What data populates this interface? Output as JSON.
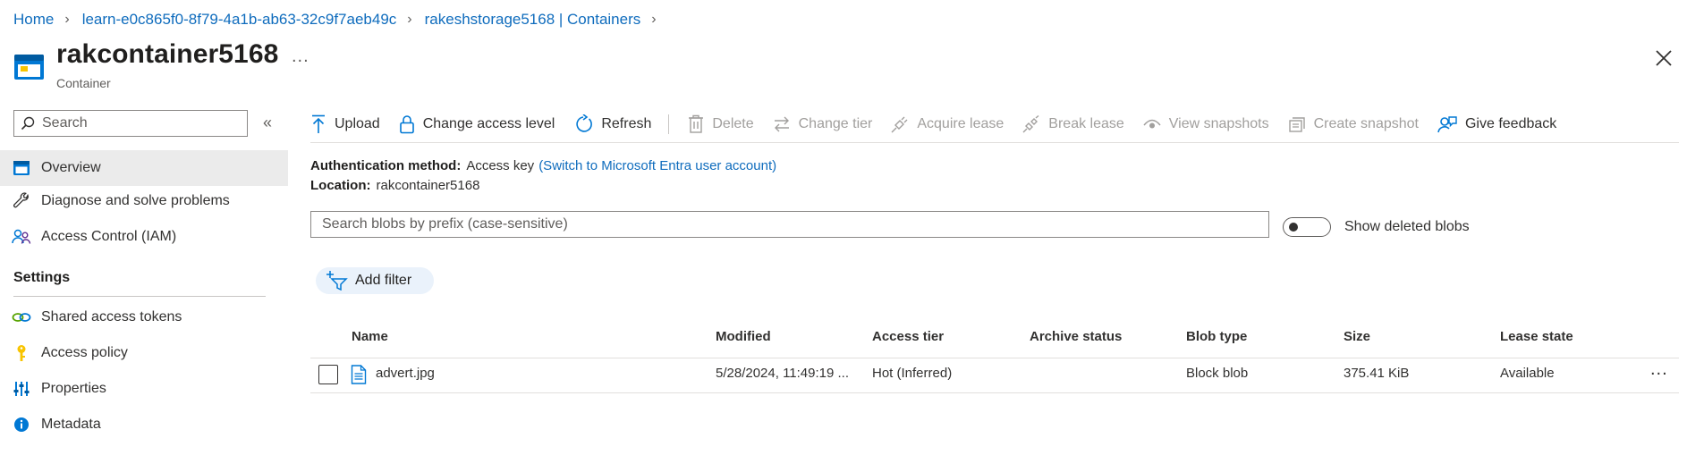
{
  "breadcrumb": [
    {
      "label": "Home"
    },
    {
      "label": "learn-e0c865f0-8f79-4a1b-ab63-32c9f7aeb49c"
    },
    {
      "label": "rakeshstorage5168 | Containers"
    }
  ],
  "header": {
    "title": "rakcontainer5168",
    "subtitle": "Container",
    "more": "...",
    "icon": "container-icon",
    "close_icon": "close-icon"
  },
  "sidebar": {
    "search_placeholder": "Search",
    "collapse_label": "«",
    "items": [
      {
        "label": "Overview",
        "icon": "overview-icon",
        "active": true
      },
      {
        "label": "Diagnose and solve problems",
        "icon": "wrench-icon"
      },
      {
        "label": "Access Control (IAM)",
        "icon": "people-icon"
      }
    ],
    "settings": {
      "title": "Settings",
      "items": [
        {
          "label": "Shared access tokens",
          "icon": "link-icon"
        },
        {
          "label": "Access policy",
          "icon": "key-icon"
        },
        {
          "label": "Properties",
          "icon": "sliders-icon"
        },
        {
          "label": "Metadata",
          "icon": "info-icon"
        }
      ]
    }
  },
  "toolbar": {
    "upload": "Upload",
    "change_access_level": "Change access level",
    "refresh": "Refresh",
    "delete": "Delete",
    "change_tier": "Change tier",
    "acquire_lease": "Acquire lease",
    "break_lease": "Break lease",
    "view_snapshots": "View snapshots",
    "create_snapshot": "Create snapshot",
    "give_feedback": "Give feedback"
  },
  "info": {
    "auth_label": "Authentication method:",
    "auth_value": "Access key",
    "auth_link": "(Switch to Microsoft Entra user account)",
    "location_label": "Location:",
    "location_value": "rakcontainer5168"
  },
  "blob_search": {
    "placeholder": "Search blobs by prefix (case-sensitive)"
  },
  "show_deleted": {
    "label": "Show deleted blobs",
    "on": false
  },
  "filter": {
    "add_label": "Add filter"
  },
  "table": {
    "columns": [
      "Name",
      "Modified",
      "Access tier",
      "Archive status",
      "Blob type",
      "Size",
      "Lease state"
    ],
    "rows": [
      {
        "name": "advert.jpg",
        "modified": "5/28/2024, 11:49:19 ...",
        "access_tier": "Hot (Inferred)",
        "archive_status": "",
        "blob_type": "Block blob",
        "size": "375.41 KiB",
        "lease_state": "Available",
        "more": "..."
      }
    ]
  },
  "colors": {
    "link": "#0f6cbd",
    "accent": "#0078d4",
    "disabled": "#a19f9d",
    "active_bg": "#ebebeb",
    "key_yellow": "#f8c400"
  }
}
